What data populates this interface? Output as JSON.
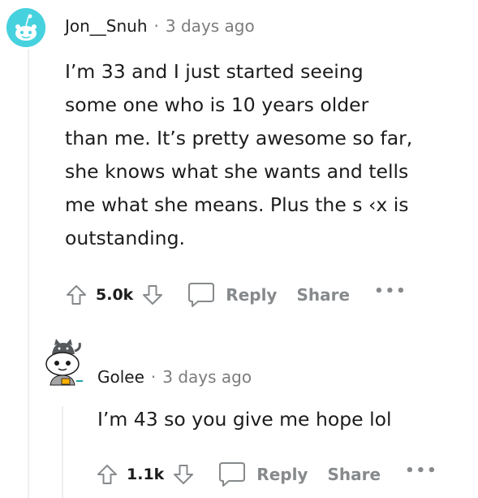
{
  "comments": [
    {
      "username": "Jon__Snuh",
      "separator": "·",
      "time": "3 days ago",
      "lines": [
        "I’m 33 and I just started seeing",
        "some one who is 10 years older",
        "than me. It’s pretty awesome so far,",
        "she knows what she wants and tells",
        "me what she means. Plus the s ‹x is",
        "outstanding."
      ],
      "score": "5.0k",
      "reply_label": "Reply",
      "share_label": "Share",
      "more_label": "•••"
    },
    {
      "username": "Golee",
      "separator": "·",
      "time": "3 days ago",
      "lines": [
        "I’m 43 so you give me hope lol"
      ],
      "score": "1.1k",
      "reply_label": "Reply",
      "share_label": "Share",
      "more_label": "•••"
    }
  ],
  "colors": {
    "avatar1_bg": "#46d1df",
    "meta_gray": "#7c7c7c",
    "action_gray": "#878a8c",
    "thread_line": "#edeff1"
  },
  "icons": {
    "upvote": "upvote-arrow-icon",
    "downvote": "downvote-arrow-icon",
    "comment": "speech-bubble-icon",
    "more": "ellipsis-icon"
  }
}
